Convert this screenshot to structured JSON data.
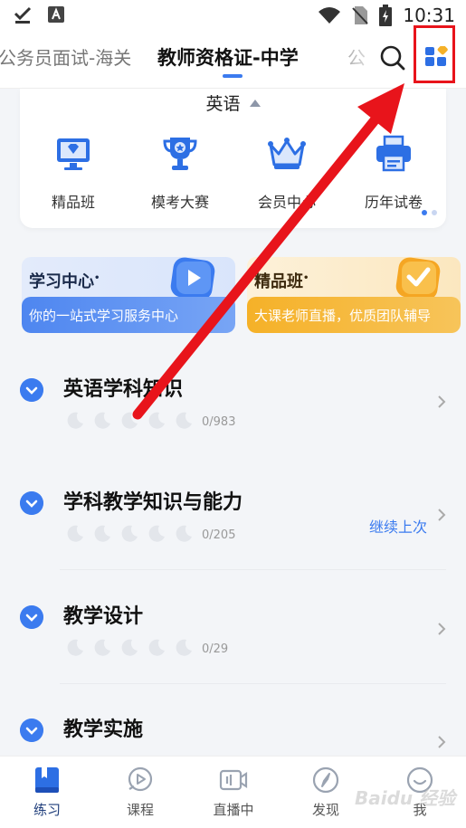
{
  "status_bar": {
    "time": "10:31",
    "left_icons": [
      "download-done-icon",
      "font-a-icon"
    ],
    "right_icons": [
      "wifi-icon",
      "no-sim-icon",
      "battery-charging-icon"
    ]
  },
  "header": {
    "tabs": [
      {
        "label": "公务员面试-海关",
        "active": false
      },
      {
        "label": "教师资格证-中学",
        "active": true
      },
      {
        "label": "公务",
        "active": false
      }
    ],
    "icons": [
      "search-icon",
      "category-grid-icon"
    ]
  },
  "subject_card": {
    "subject": "英语",
    "entries": [
      {
        "label": "精品班",
        "icon": "monitor-icon"
      },
      {
        "label": "模考大赛",
        "icon": "trophy-icon"
      },
      {
        "label": "会员中心",
        "icon": "crown-icon"
      },
      {
        "label": "历年试卷",
        "icon": "printer-icon"
      }
    ],
    "page_index": 1,
    "page_count": 2
  },
  "banners": [
    {
      "title": "学习中心",
      "subtitle": "你的一站式学习服务中心"
    },
    {
      "title": "精品班",
      "subtitle": "大课老师直播，优质团队辅导"
    }
  ],
  "chapters": [
    {
      "name": "英语学科知识",
      "progress": "0/983",
      "continue": ""
    },
    {
      "name": "学科教学知识与能力",
      "progress": "0/205",
      "continue": "继续上次"
    },
    {
      "name": "教学设计",
      "progress": "0/29",
      "continue": ""
    },
    {
      "name": "教学实施",
      "progress": "",
      "continue": ""
    }
  ],
  "bottom_nav": [
    {
      "label": "练习",
      "icon": "book-icon",
      "active": true
    },
    {
      "label": "课程",
      "icon": "play-circle-icon",
      "active": false
    },
    {
      "label": "直播中",
      "icon": "video-camera-icon",
      "active": false
    },
    {
      "label": "发现",
      "icon": "compass-icon",
      "active": false
    },
    {
      "label": "我",
      "icon": "smile-face-icon",
      "active": false
    }
  ],
  "annotation": {
    "highlight_color": "#e8141b"
  },
  "watermark": "Baidu 经验",
  "colors": {
    "accent": "#3b7bef",
    "gold": "#f5b128"
  }
}
